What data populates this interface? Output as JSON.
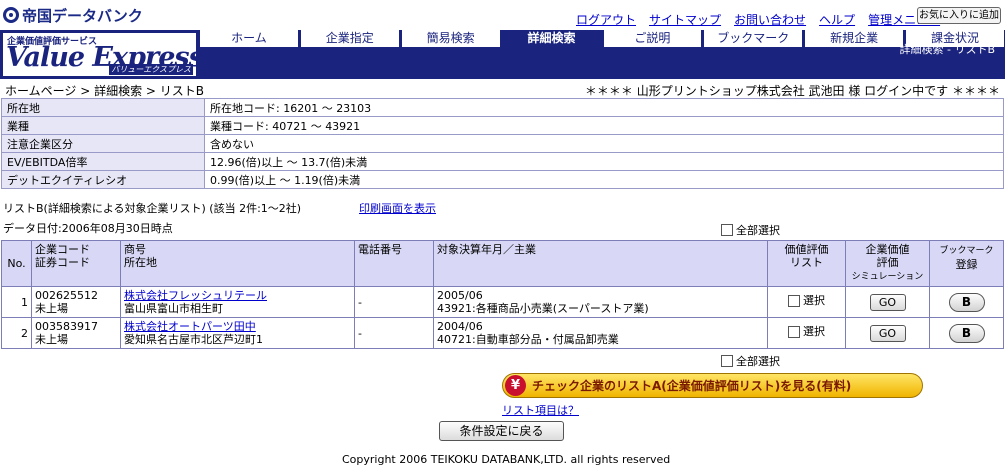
{
  "brand": {
    "logo_text": "帝国データバンク"
  },
  "top_links": [
    "ログアウト",
    "サイトマップ",
    "お問い合わせ",
    "ヘルプ",
    "管理メニュー"
  ],
  "favorite_button": "お気に入りに追加",
  "product": {
    "small_label": "企業価値評価サービス",
    "name": "Value Express",
    "kana": "バリューエクスプレス"
  },
  "header_crumb": "詳細検索 - リストB",
  "nav_tabs": [
    {
      "label": "ホーム"
    },
    {
      "label": "企業指定"
    },
    {
      "label": "簡易検索"
    },
    {
      "label": "詳細検索"
    },
    {
      "label": "ご説明"
    },
    {
      "label": "ブックマーク"
    },
    {
      "label": "新規企業"
    },
    {
      "label": "課金状況"
    }
  ],
  "breadcrumb": "ホームページ > 詳細検索 > リストB",
  "user_info": "＊＊＊＊ 山形プリントショップ株式会社 武池田 様 ログイン中です ＊＊＊＊",
  "conditions": [
    {
      "label": "所在地",
      "value": "所在地コード: 16201 〜 23103"
    },
    {
      "label": "業種",
      "value": "業種コード: 40721 〜 43921"
    },
    {
      "label": "注意企業区分",
      "value": "含めない"
    },
    {
      "label": "EV/EBITDA倍率",
      "value": "12.96(倍)以上 〜 13.7(倍)未満"
    },
    {
      "label": "デットエクイティレシオ",
      "value": "0.99(倍)以上 〜 1.19(倍)未満"
    }
  ],
  "list_info": "リストB(詳細検索による対象企業リスト) (該当 2件:1〜2社)",
  "print_link": "印刷画面を表示",
  "data_date": "データ日付:2006年08月30日時点",
  "select_all": "全部選択",
  "table_headers": {
    "no": "No.",
    "code1": "企業コード",
    "code2": "証券コード",
    "name1": "商号",
    "name2": "所在地",
    "phone": "電話番号",
    "period": "対象決算年月／主業",
    "eval1": "価値評価",
    "eval2": "リスト",
    "sim1": "企業価値",
    "sim2": "評価",
    "sim3": "シミュレーション",
    "bm1": "ブックマーク",
    "bm2": "登録"
  },
  "rows": [
    {
      "no": "1",
      "code": "002625512",
      "listing": "未上場",
      "name": "株式会社フレッシュリテール",
      "address": "富山県富山市相生町",
      "phone": "-",
      "period": "2005/06",
      "business": "43921:各種商品小売業(スーパーストア業)",
      "select": "選択",
      "go": "GO",
      "bookmark": "B"
    },
    {
      "no": "2",
      "code": "003583917",
      "listing": "未上場",
      "name": "株式会社オートパーツ田中",
      "address": "愛知県名古屋市北区芦辺町1",
      "phone": "-",
      "period": "2004/06",
      "business": "40721:自動車部分品・付属品卸売業",
      "select": "選択",
      "go": "GO",
      "bookmark": "B"
    }
  ],
  "promo": {
    "icon": "¥",
    "text": "チェック企業のリストA(企業価値評価リスト)を見る(有料)"
  },
  "list_item_link": "リスト項目は？",
  "back_button": "条件設定に戻る",
  "copyright": "Copyright 2006 TEIKOKU DATABANK,LTD. all rights reserved",
  "colors": {
    "brand_navy": "#1a237e",
    "header_cell": "#d8d8f6",
    "label_cell": "#e6e6f6",
    "promo_gold": "#f0b400"
  }
}
